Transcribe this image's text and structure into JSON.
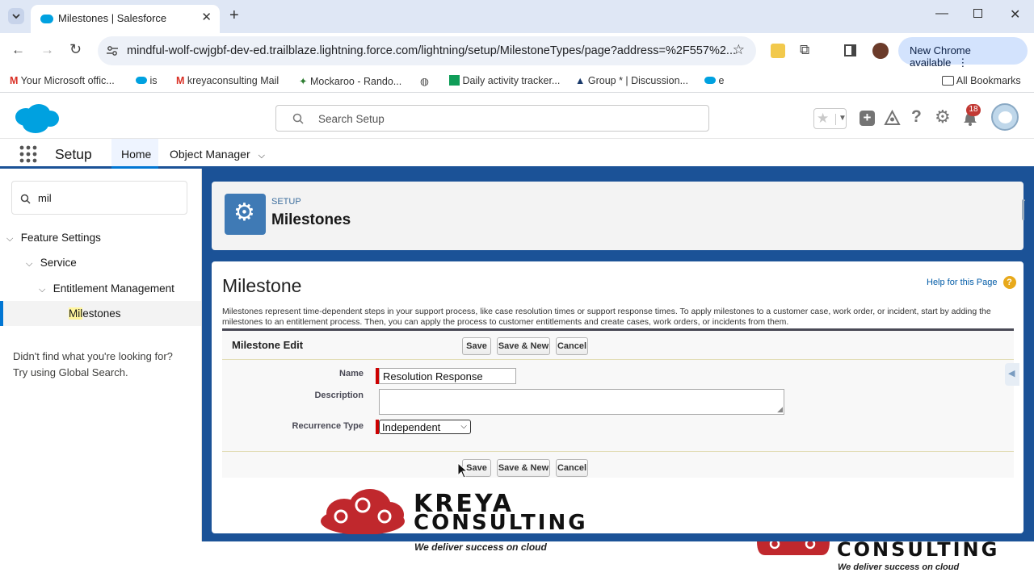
{
  "browser": {
    "tab_title": "Milestones | Salesforce",
    "url": "mindful-wolf-cwjgbf-dev-ed.trailblaze.lightning.force.com/lightning/setup/MilestoneTypes/page?address=%2F557%2...",
    "new_chrome_label": "New Chrome available",
    "bookmarks": [
      "Your Microsoft offic...",
      "is",
      "kreyaconsulting Mail",
      "Mockaroo - Rando...",
      "Daily activity tracker...",
      "Group * | Discussion...",
      "e"
    ],
    "all_bookmarks": "All Bookmarks"
  },
  "sf": {
    "search_placeholder": "Search Setup",
    "notification_count": "18",
    "app_name": "Setup",
    "tabs": [
      "Home",
      "Object Manager"
    ]
  },
  "sidebar": {
    "quick_find_value": "mil",
    "tree": {
      "feature_settings": "Feature Settings",
      "service": "Service",
      "entitlement_management": "Entitlement Management",
      "milestones_match": "Mil",
      "milestones_rest": "estones"
    },
    "not_found_line1": "Didn't find what you're looking for?",
    "not_found_line2": "Try using Global Search."
  },
  "page": {
    "setup_label": "SETUP",
    "title": "Milestones",
    "section_title": "Milestone",
    "help_link": "Help for this Page",
    "description": "Milestones represent time-dependent steps in your support process, like case resolution times or support response times. To apply milestones to a customer case, work order, or incident, start by adding the milestones to an entitlement process. Then, you can apply the process to customer entitlements and create cases, work orders, or incidents from them.",
    "edit_title": "Milestone Edit",
    "buttons": {
      "save": "Save",
      "save_new": "Save & New",
      "cancel": "Cancel"
    },
    "fields": {
      "name_label": "Name",
      "name_value": "Resolution Response",
      "description_label": "Description",
      "recurrence_label": "Recurrence Type",
      "recurrence_value": "Independent"
    }
  },
  "watermark": {
    "line1": "KREYA",
    "line2": "CONSULTING",
    "tagline": "We deliver success on cloud"
  },
  "colors": {
    "sf_brand": "#1b5297",
    "sf_blue": "#0176d3",
    "required": "#c00000",
    "kreya_red": "#c0282d"
  }
}
